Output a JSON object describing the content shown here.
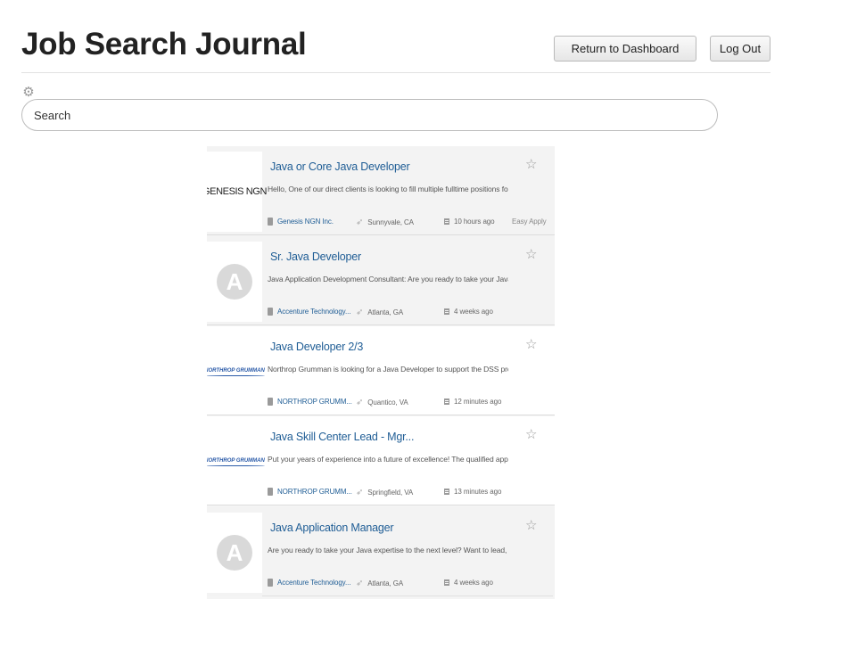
{
  "header": {
    "title": "Job Search Journal",
    "dashboard_button": "Return to Dashboard",
    "logout_button": "Log Out"
  },
  "search": {
    "placeholder": "Search",
    "settings_icon": "gear-icon"
  },
  "jobs": [
    {
      "logo_text": "GENESIS NGN",
      "logo_type": "text",
      "title": "Java or Core Java Developer",
      "description": "Hello, One of our direct clients is looking to fill multiple fulltime positions for...",
      "company": "Genesis NGN Inc.",
      "location": "Sunnyvale, CA",
      "posted": "10 hours ago",
      "apply": "Easy Apply"
    },
    {
      "logo_text": "A",
      "logo_type": "avatar",
      "title": "Sr. Java Developer",
      "description": "Java Application Development Consultant: Are you ready to take your Java...",
      "company": "Accenture Technology...",
      "location": "Atlanta, GA",
      "posted": "4 weeks ago",
      "apply": ""
    },
    {
      "logo_text": "NORTHROP GRUMMAN",
      "logo_type": "northrop",
      "title": "Java Developer 2/3",
      "description": "Northrop Grumman is looking for a Java Developer to support the DSS pro...",
      "company": "NORTHROP GRUMM...",
      "location": "Quantico, VA",
      "posted": "12 minutes ago",
      "apply": ""
    },
    {
      "logo_text": "NORTHROP GRUMMAN",
      "logo_type": "northrop",
      "title": "Java Skill Center Lead - Mgr...",
      "description": "Put your years of experience into a future of excellence! The qualified appli...",
      "company": "NORTHROP GRUMM...",
      "location": "Springfield, VA",
      "posted": "13 minutes ago",
      "apply": ""
    },
    {
      "logo_text": "A",
      "logo_type": "avatar",
      "title": "Java Application Manager",
      "description": "Are you ready to take your Java expertise to the next level? Want to lead, i...",
      "company": "Accenture Technology...",
      "location": "Atlanta, GA",
      "posted": "4 weeks ago",
      "apply": ""
    }
  ],
  "colors": {
    "link": "#1f5d95",
    "card_bg": "#f3f3f3"
  }
}
